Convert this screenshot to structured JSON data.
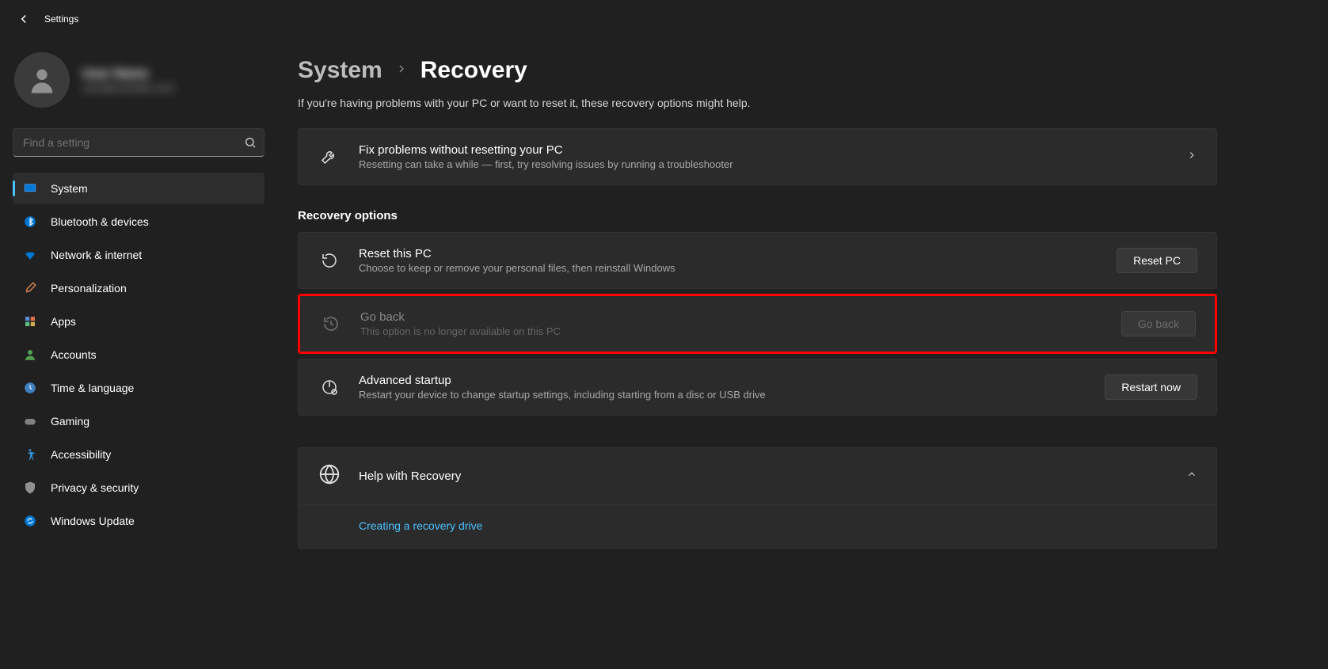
{
  "app_title": "Settings",
  "profile": {
    "name": "User Name",
    "email": "user@example.com"
  },
  "search": {
    "placeholder": "Find a setting"
  },
  "sidebar": {
    "items": [
      {
        "id": "system",
        "label": "System",
        "active": true
      },
      {
        "id": "bluetooth",
        "label": "Bluetooth & devices"
      },
      {
        "id": "network",
        "label": "Network & internet"
      },
      {
        "id": "personalization",
        "label": "Personalization"
      },
      {
        "id": "apps",
        "label": "Apps"
      },
      {
        "id": "accounts",
        "label": "Accounts"
      },
      {
        "id": "time",
        "label": "Time & language"
      },
      {
        "id": "gaming",
        "label": "Gaming"
      },
      {
        "id": "accessibility",
        "label": "Accessibility"
      },
      {
        "id": "privacy",
        "label": "Privacy & security"
      },
      {
        "id": "update",
        "label": "Windows Update"
      }
    ]
  },
  "breadcrumb": {
    "parent": "System",
    "current": "Recovery"
  },
  "intro": "If you're having problems with your PC or want to reset it, these recovery options might help.",
  "troubleshoot": {
    "title": "Fix problems without resetting your PC",
    "sub": "Resetting can take a while — first, try resolving issues by running a troubleshooter"
  },
  "section_heading": "Recovery options",
  "reset": {
    "title": "Reset this PC",
    "sub": "Choose to keep or remove your personal files, then reinstall Windows",
    "button": "Reset PC"
  },
  "goback": {
    "title": "Go back",
    "sub": "This option is no longer available on this PC",
    "button": "Go back"
  },
  "advanced": {
    "title": "Advanced startup",
    "sub": "Restart your device to change startup settings, including starting from a disc or USB drive",
    "button": "Restart now"
  },
  "help": {
    "title": "Help with Recovery",
    "link": "Creating a recovery drive"
  }
}
